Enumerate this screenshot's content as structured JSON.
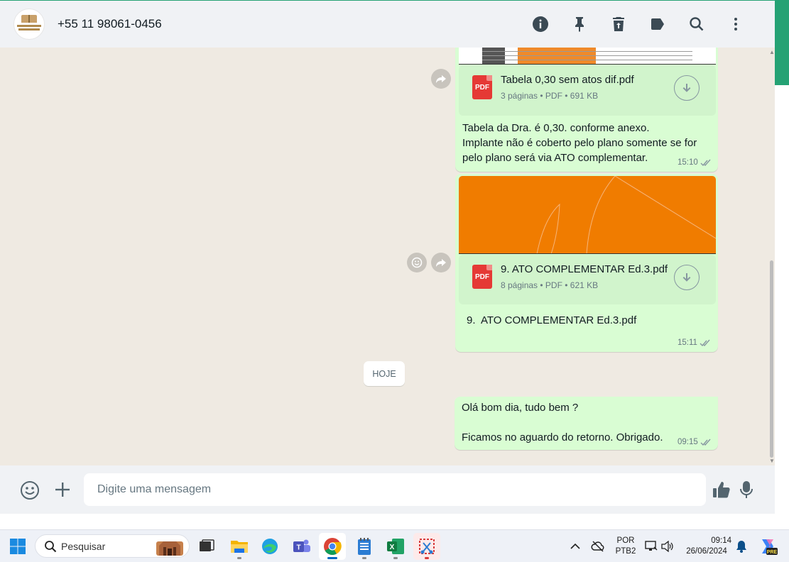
{
  "header": {
    "contact_name": "+55 11 98061-0456",
    "icons": [
      "info-icon",
      "pin-icon",
      "trash-icon",
      "label-icon",
      "search-icon",
      "more-vertical-icon"
    ]
  },
  "messages": [
    {
      "type": "document",
      "file_name": "Tabela 0,30 sem atos dif.pdf",
      "meta": "3 páginas • PDF • 691 KB",
      "file_icon": "PDF",
      "caption_lines": [
        "Tabela da Dra. é 0,30. conforme anexo.",
        "Implante não é coberto pelo plano somente se for",
        "pelo plano será via ATO complementar."
      ],
      "time": "15:10"
    },
    {
      "type": "document",
      "file_name": "9. ATO COMPLEMENTAR Ed.3.pdf",
      "meta": "8 páginas • PDF • 621 KB",
      "file_icon": "PDF",
      "caption": "9.  ATO COMPLEMENTAR Ed.3.pdf",
      "time": "15:11"
    },
    {
      "type": "text",
      "lines": [
        "Olá bom dia, tudo bem ?",
        "",
        "Ficamos no aguardo do retorno. Obrigado."
      ],
      "time": "09:15"
    }
  ],
  "day_divider": "HOJE",
  "compose": {
    "placeholder": "Digite uma mensagem"
  },
  "taskbar": {
    "search_placeholder": "Pesquisar",
    "language_line1": "POR",
    "language_line2": "PTB2",
    "time": "09:14",
    "date": "26/06/2024",
    "copilot_badge": "PRE"
  },
  "colors": {
    "bubble_out": "#d9fdd3",
    "chat_bg": "#efeae2",
    "accent_green": "#25a274",
    "pdf_red": "#e53935",
    "thumb_orange": "#f07c00"
  }
}
